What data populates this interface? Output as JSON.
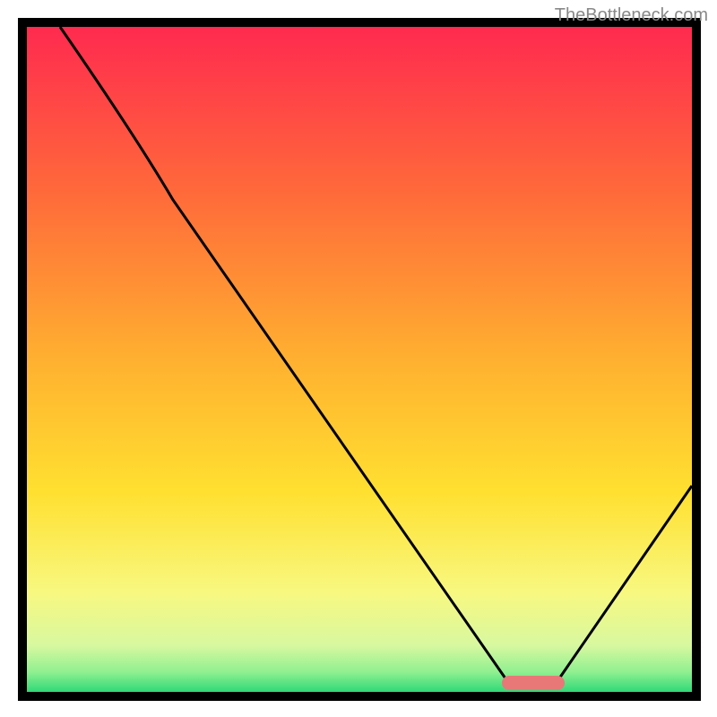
{
  "watermark": "TheBottleneck.com",
  "chart_data": {
    "type": "line",
    "title": "",
    "xlabel": "",
    "ylabel": "",
    "xlim": [
      0,
      100
    ],
    "ylim": [
      0,
      100
    ],
    "background": {
      "type": "vertical-gradient",
      "stops": [
        {
          "offset": 0,
          "color": "#ff2a4f"
        },
        {
          "offset": 25,
          "color": "#ff6a3a"
        },
        {
          "offset": 50,
          "color": "#ffb030"
        },
        {
          "offset": 70,
          "color": "#ffe030"
        },
        {
          "offset": 85,
          "color": "#f8f880"
        },
        {
          "offset": 95,
          "color": "#c8f8a0"
        },
        {
          "offset": 100,
          "color": "#30e080"
        }
      ]
    },
    "curve": [
      {
        "x": 5,
        "y": 100
      },
      {
        "x": 22,
        "y": 74
      },
      {
        "x": 72,
        "y": 2
      },
      {
        "x": 80,
        "y": 2
      },
      {
        "x": 100,
        "y": 31
      }
    ],
    "marker": {
      "x_start": 72,
      "x_end": 80,
      "y": 2,
      "color": "#e87878"
    },
    "frame_color": "#000000"
  }
}
